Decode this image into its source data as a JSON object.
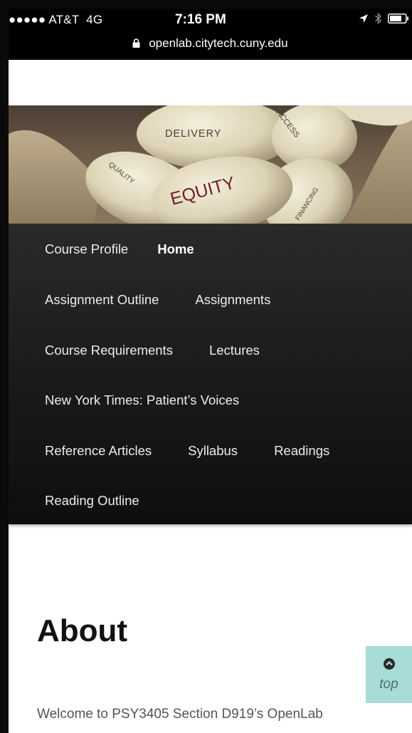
{
  "status_bar": {
    "carrier": "●●●●● AT&T",
    "network": "4G",
    "time": "7:16 PM",
    "url": "openlab.citytech.cuny.edu",
    "icons": [
      "location-arrow-icon",
      "bluetooth-icon",
      "battery-icon"
    ]
  },
  "banner": {
    "words": [
      "DELIVERY",
      "ACCESS",
      "QUALITY",
      "EQUITY",
      "FINANCING"
    ]
  },
  "nav": {
    "items": [
      {
        "label": "Course Profile",
        "active": false
      },
      {
        "label": "Home",
        "active": true
      },
      {
        "label": "Assignment Outline",
        "active": false
      },
      {
        "label": "Assignments",
        "active": false
      },
      {
        "label": "Course Requirements",
        "active": false
      },
      {
        "label": "Lectures",
        "active": false
      },
      {
        "label": "New York Times: Patient’s Voices",
        "active": false
      },
      {
        "label": "Reference Articles",
        "active": false
      },
      {
        "label": "Syllabus",
        "active": false
      },
      {
        "label": "Readings",
        "active": false
      },
      {
        "label": "Reading Outline",
        "active": false
      }
    ]
  },
  "content": {
    "title": "About",
    "intro": "Welcome to PSY3405 Section D919’s OpenLab"
  },
  "top_button": {
    "label": "top",
    "icon": "chevron-up-circle-icon"
  },
  "colors": {
    "nav_bg": "#1b1b1b",
    "top_button_bg": "#a7dcd8",
    "equity_text": "#6e1f2a"
  }
}
